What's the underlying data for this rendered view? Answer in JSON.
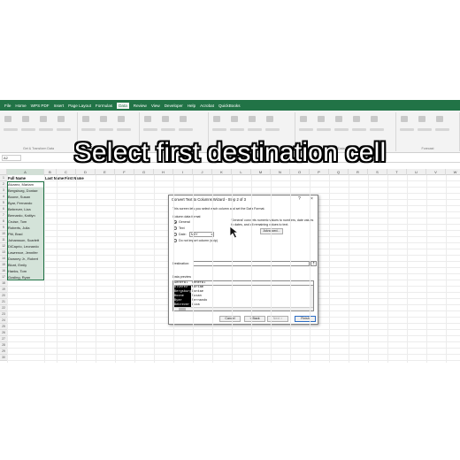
{
  "caption": "Select first destination cell",
  "ribbon": {
    "tabs": [
      {
        "label": "File",
        "active": false
      },
      {
        "label": "Home",
        "active": false
      },
      {
        "label": "WPS PDF",
        "active": false
      },
      {
        "label": "Insert",
        "active": false
      },
      {
        "label": "Page Layout",
        "active": false
      },
      {
        "label": "Formulas",
        "active": false
      },
      {
        "label": "Data",
        "active": true
      },
      {
        "label": "Review",
        "active": false
      },
      {
        "label": "View",
        "active": false
      },
      {
        "label": "Developer",
        "active": false
      },
      {
        "label": "Help",
        "active": false
      },
      {
        "label": "Acrobat",
        "active": false
      },
      {
        "label": "QuickBooks",
        "active": false
      }
    ],
    "groups": [
      "Get & Transform Data",
      "Queries & Connections",
      "Data Types",
      "Sort & Filter",
      "Data Tools",
      "Forecast"
    ]
  },
  "namebox": "A2",
  "sheet": {
    "columns": [
      "A",
      "B",
      "C",
      "D",
      "E",
      "F",
      "G",
      "H",
      "I",
      "J",
      "K",
      "L",
      "M",
      "N",
      "O",
      "P",
      "Q",
      "R",
      "S",
      "T",
      "U",
      "V",
      "W"
    ],
    "headers": {
      "a": "Full Name",
      "b": "Last Name",
      "c": "First Name"
    },
    "names": [
      "Alvarez, Mariam",
      "Bergsburg, Dontae",
      "Boone, Susan",
      "Byar, Fernando",
      "Bebrever, Liza",
      "Bernardo, Kaitlyn",
      "Cruise, Tom",
      "Roberts, Julia",
      "Pitt, Brad",
      "Johansson, Scarlett",
      "DiCaprio, Leonardo",
      "Lawrence, Jennifer",
      "Downey Jr., Robert",
      "Blunt, Emily",
      "Hanks, Tom",
      "Gosling, Ryan"
    ]
  },
  "dialog": {
    "title": "Convert Text to Columns Wizard - Step 2 of 3",
    "help": "?",
    "close": "×",
    "intro": "This screen lets you select each column and set the Data Format.",
    "column_format_label": "Column data format",
    "options": [
      {
        "label": "General",
        "selected": true
      },
      {
        "label": "Text",
        "selected": false
      },
      {
        "label": "Date:",
        "selected": false
      },
      {
        "label": "Do not import column (skip)",
        "selected": false
      }
    ],
    "date_format": "MDY",
    "general_note_1": "'General' converts numeric values to numbers, date values",
    "general_note_2": "to dates, and all remaining values to text.",
    "advanced_button": "Advanced...",
    "destination_label": "Destination:",
    "destination_value": "",
    "preview_label": "Data preview",
    "preview_header": [
      "General",
      "General"
    ],
    "preview_rows": [
      [
        "Alvarez",
        "Mariam"
      ],
      [
        "Bergsburg",
        "Dontae"
      ],
      [
        "Boone",
        "Susan"
      ],
      [
        "Byar",
        "Fernando"
      ],
      [
        "Bebrever",
        "Liza"
      ]
    ],
    "buttons": {
      "cancel": "Cancel",
      "back": "< Back",
      "next": "Next >",
      "finish": "Finish"
    }
  }
}
